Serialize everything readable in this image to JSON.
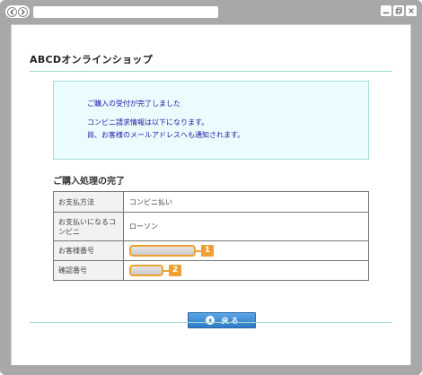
{
  "shop": {
    "title": "ABCDオンラインショップ"
  },
  "notice": {
    "line1": "ご購入の受付が完了しました",
    "line2": "コンビニ請求情報は以下になります。",
    "line3": "尚、お客様のメールアドレスへも通知されます。"
  },
  "section": {
    "title": "ご購入処理の完了"
  },
  "table": {
    "rows": [
      {
        "label": "お支払方法",
        "value": "コンビニ払い"
      },
      {
        "label": "お支払いになるコンビニ",
        "value": "ローソン"
      },
      {
        "label": "お客様番号",
        "value": ""
      },
      {
        "label": "確認番号",
        "value": ""
      }
    ]
  },
  "markers": {
    "m1": "1",
    "m2": "2"
  },
  "actions": {
    "back_label": "戻 る"
  },
  "colors": {
    "accent_blue": "#2f7ac7",
    "marker_orange": "#f0a032",
    "notice_text": "#1a1aa8",
    "notice_bg": "#eafcfd"
  }
}
